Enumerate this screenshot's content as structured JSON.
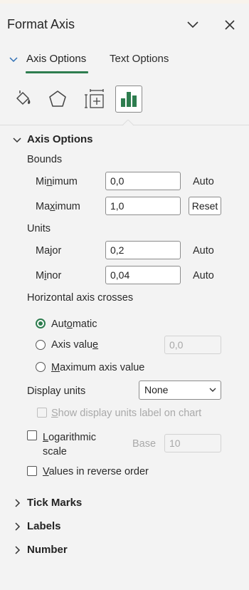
{
  "panel": {
    "title": "Format Axis"
  },
  "tabs": {
    "axis_options": "Axis Options",
    "text_options": "Text Options"
  },
  "icons": [
    "paint-bucket-icon",
    "pentagon-icon",
    "size-properties-icon",
    "bar-chart-icon"
  ],
  "axis_options": {
    "section_title": "Axis Options",
    "bounds": {
      "label": "Bounds",
      "minimum": {
        "pre": "Mi",
        "ul": "n",
        "post": "imum",
        "value": "0,0",
        "action": "Auto"
      },
      "maximum": {
        "pre": "Ma",
        "ul": "x",
        "post": "imum",
        "value": "1,0",
        "action": "Reset"
      }
    },
    "units": {
      "label": "Units",
      "major": {
        "pre": "Ma",
        "ul": "j",
        "post": "or",
        "value": "0,2",
        "action": "Auto"
      },
      "minor": {
        "pre": "M",
        "ul": "i",
        "post": "nor",
        "value": "0,04",
        "action": "Auto"
      }
    },
    "crosses": {
      "label": "Horizontal axis crosses",
      "automatic": {
        "pre": "Aut",
        "ul": "o",
        "post": "matic"
      },
      "axis_value": {
        "pre": "Axis valu",
        "ul": "e",
        "post": "",
        "value": "0,0"
      },
      "maximum": {
        "pre": "",
        "ul": "M",
        "post": "aximum axis value"
      }
    },
    "display_units": {
      "label": "Display units",
      "value": "None",
      "show_label": {
        "pre": "",
        "ul": "S",
        "post": "how display units label on chart"
      }
    },
    "log_scale": {
      "line1_pre": "",
      "line1_ul": "L",
      "line1_post": "ogarithmic",
      "line2": "scale",
      "base_label": "Base",
      "base_value": "10"
    },
    "reverse": {
      "pre": "",
      "ul": "V",
      "post": "alues in reverse order"
    }
  },
  "collapsed_sections": {
    "tick_marks": "Tick Marks",
    "labels": "Labels",
    "number": "Number"
  },
  "colors": {
    "accent": "#2e7d4f",
    "background": "#f3f3f3"
  }
}
